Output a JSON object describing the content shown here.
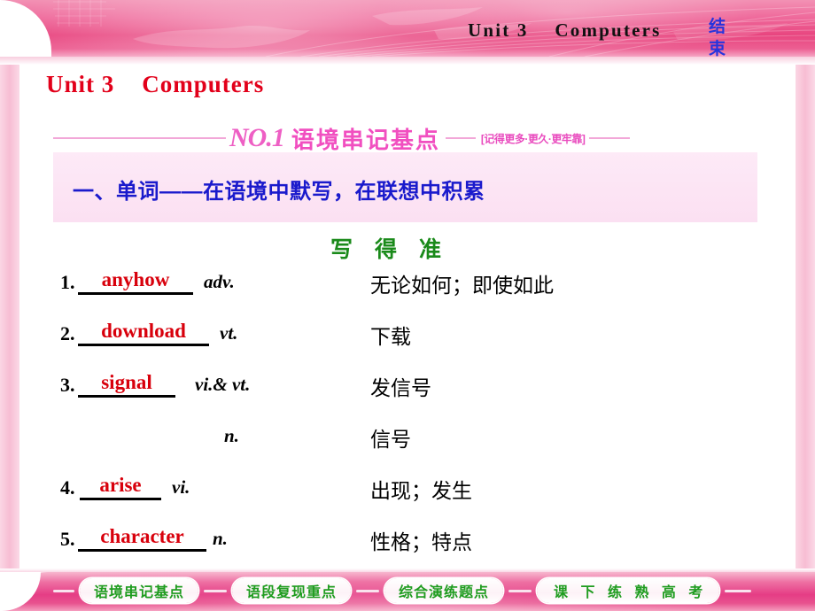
{
  "header": {
    "title": "Unit 3    Computers",
    "end_button": "结束"
  },
  "unit_heading": "Unit 3    Computers",
  "section": {
    "number": "NO.1",
    "name": "语境串记基点",
    "tag": "[记得更多·更久·更牢靠]"
  },
  "subtitle": "一、单词——在语境中默写，在联想中积累",
  "green_heading": "写 得 准",
  "words": [
    {
      "num": "1.",
      "word": "anyhow",
      "pos": "adv.",
      "meaning": "无论如何；即使如此"
    },
    {
      "num": "2.",
      "word": "download",
      "pos": "vt.",
      "meaning": "下载"
    },
    {
      "num": "3.",
      "word": "signal",
      "pos": "vi.& vt.",
      "meaning": "发信号"
    },
    {
      "num": "",
      "word": "",
      "pos": "n.",
      "meaning": "信号"
    },
    {
      "num": "4.",
      "word": "arise",
      "pos": "vi.",
      "meaning": "出现；发生"
    },
    {
      "num": "5.",
      "word": "character",
      "pos": "n.",
      "meaning": "性格；特点"
    }
  ],
  "nav": {
    "items": [
      {
        "label": "语境串记基点"
      },
      {
        "label": "语段复现重点"
      },
      {
        "label": "综合演练题点"
      },
      {
        "label": "课 下 练 熟 高 考"
      }
    ]
  },
  "colors": {
    "banner_pink": "#e8457f",
    "heading_red": "#e2001a",
    "word_red": "#d8000c",
    "subtitle_blue": "#1a1acc",
    "green": "#1a8a1a",
    "magenta": "#f14fc0"
  }
}
